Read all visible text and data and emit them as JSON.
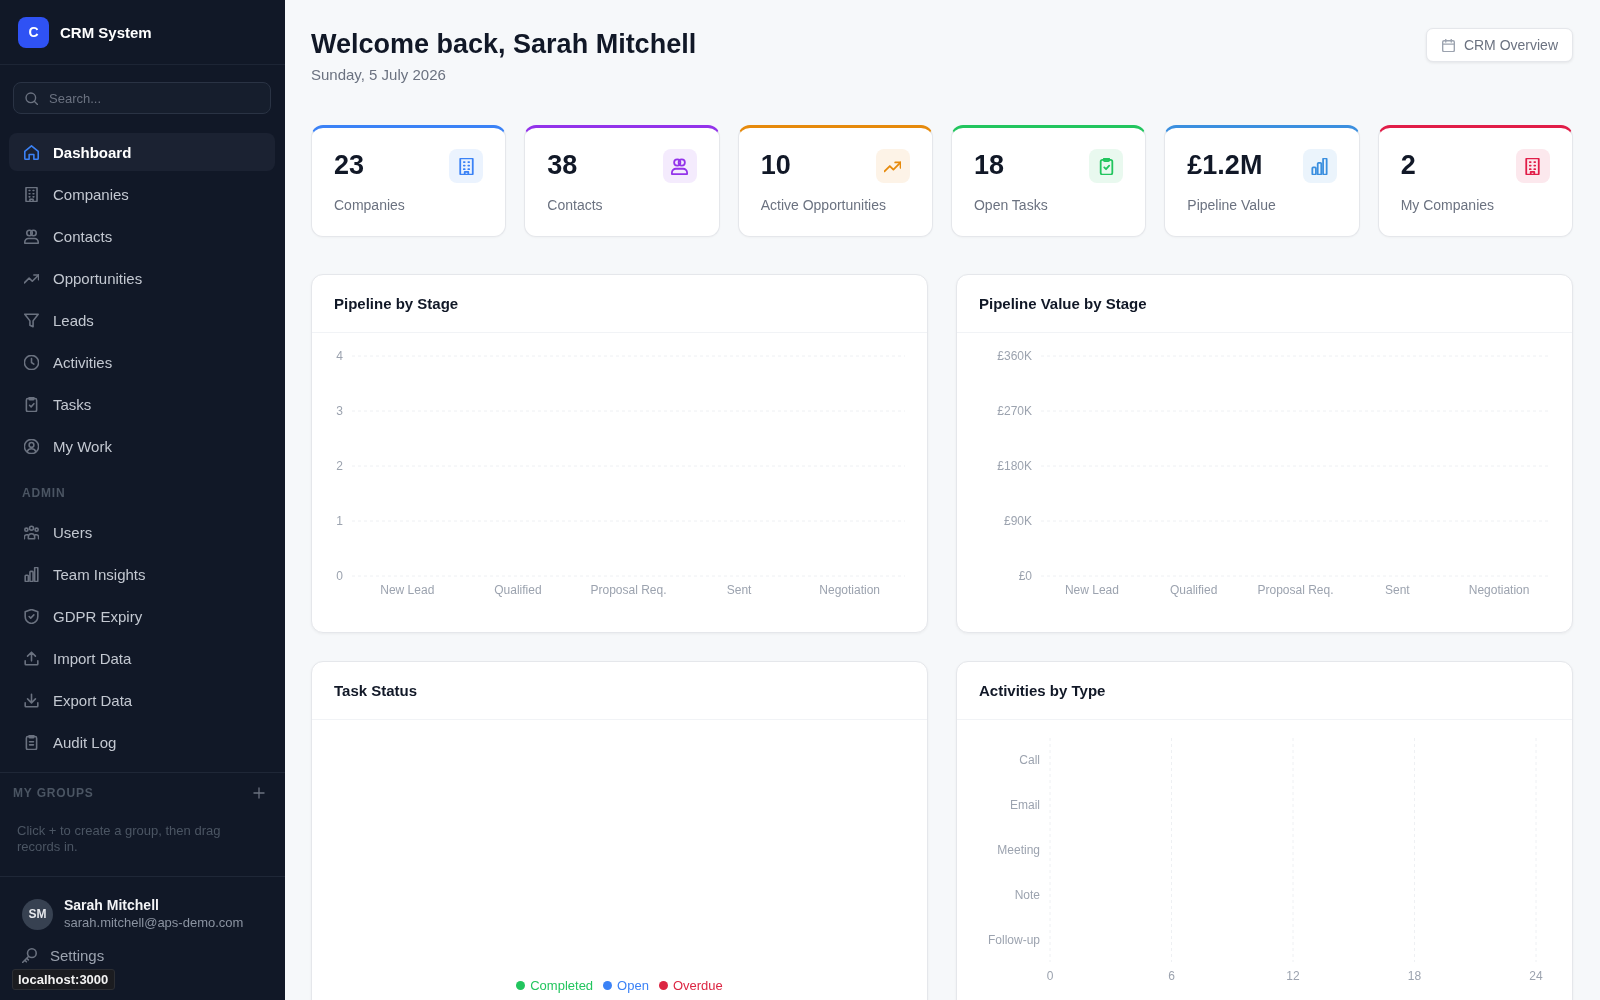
{
  "sidebar": {
    "logo_letter": "C",
    "app_name": "CRM System",
    "search": {
      "placeholder": "Search..."
    },
    "nav": [
      {
        "label": "Dashboard",
        "selected": true
      },
      {
        "label": "Companies",
        "selected": false
      },
      {
        "label": "Contacts",
        "selected": false
      },
      {
        "label": "Opportunities",
        "selected": false
      },
      {
        "label": "Leads",
        "selected": false
      },
      {
        "label": "Activities",
        "selected": false
      },
      {
        "label": "Tasks",
        "selected": false
      },
      {
        "label": "My Work",
        "selected": false
      }
    ],
    "admin": {
      "title": "ADMIN",
      "items": [
        {
          "label": "Users",
          "selected": false
        },
        {
          "label": "Team Insights",
          "selected": false
        },
        {
          "label": "GDPR Expiry",
          "selected": false
        },
        {
          "label": "Import Data",
          "selected": false
        },
        {
          "label": "Export Data",
          "selected": false
        },
        {
          "label": "Audit Log",
          "selected": false
        }
      ]
    },
    "groups": {
      "title": "MY GROUPS",
      "hint": "Click + to create a group, then drag records in."
    },
    "user": {
      "initials": "SM",
      "name": "Sarah Mitchell",
      "email": "sarah.mitchell@aps-demo.com"
    },
    "footer_items": [
      "Settings"
    ]
  },
  "header": {
    "title": "Welcome back, Sarah Mitchell",
    "date": "Sunday, 5 July 2026",
    "button": "CRM Overview"
  },
  "stats": [
    {
      "value": "23",
      "label": "Companies",
      "color": "#3b82f6"
    },
    {
      "value": "38",
      "label": "Contacts",
      "color": "#9333ea"
    },
    {
      "value": "10",
      "label": "Active Opportunities",
      "color": "#e68a0c"
    },
    {
      "value": "18",
      "label": "Open Tasks",
      "color": "#22c55e"
    },
    {
      "value": "£1.2M",
      "label": "Pipeline Value",
      "color": "#3b8fdf"
    },
    {
      "value": "2",
      "label": "My Companies",
      "color": "#e11d48"
    }
  ],
  "panels": [
    {
      "kind": "chart",
      "title": "Pipeline by Stage",
      "chart_data": {
        "type": "bar",
        "categories": [
          "New Lead",
          "Qualified",
          "Proposal Req.",
          "Sent",
          "Negotiation"
        ],
        "values": [
          0,
          0,
          0,
          0,
          0
        ],
        "ylim": [
          0,
          4
        ],
        "yticks": [
          0,
          1,
          2,
          3,
          4
        ],
        "grid": true
      }
    },
    {
      "kind": "chart",
      "title": "Pipeline Value by Stage",
      "chart_data": {
        "type": "bar",
        "categories": [
          "New Lead",
          "Qualified",
          "Proposal Req.",
          "Sent",
          "Negotiation"
        ],
        "values": [
          0,
          0,
          0,
          0,
          0
        ],
        "ylim": [
          0,
          360000
        ],
        "yticks": [
          {
            "value": 0,
            "label": "£0"
          },
          {
            "value": 90000,
            "label": "£90K"
          },
          {
            "value": 180000,
            "label": "£180K"
          },
          {
            "value": 270000,
            "label": "£270K"
          },
          {
            "value": 360000,
            "label": "£360K"
          }
        ],
        "grid": true
      }
    },
    {
      "kind": "legend",
      "title": "Task Status",
      "legend": [
        {
          "label": "Completed",
          "color": "#22c55e"
        },
        {
          "label": "Open",
          "color": "#3b82f6"
        },
        {
          "label": "Overdue",
          "color": "#dc2643"
        }
      ]
    },
    {
      "kind": "chart",
      "title": "Activities by Type",
      "chart_data": {
        "type": "bar",
        "orientation": "horizontal",
        "categories": [
          "Call",
          "Email",
          "Meeting",
          "Note",
          "Follow-up"
        ],
        "values": [
          0,
          0,
          0,
          0,
          0
        ],
        "xlim": [
          0,
          24
        ],
        "xticks": [
          0,
          6,
          12,
          18,
          24
        ],
        "grid": true
      }
    }
  ],
  "status_url": "localhost:3000"
}
